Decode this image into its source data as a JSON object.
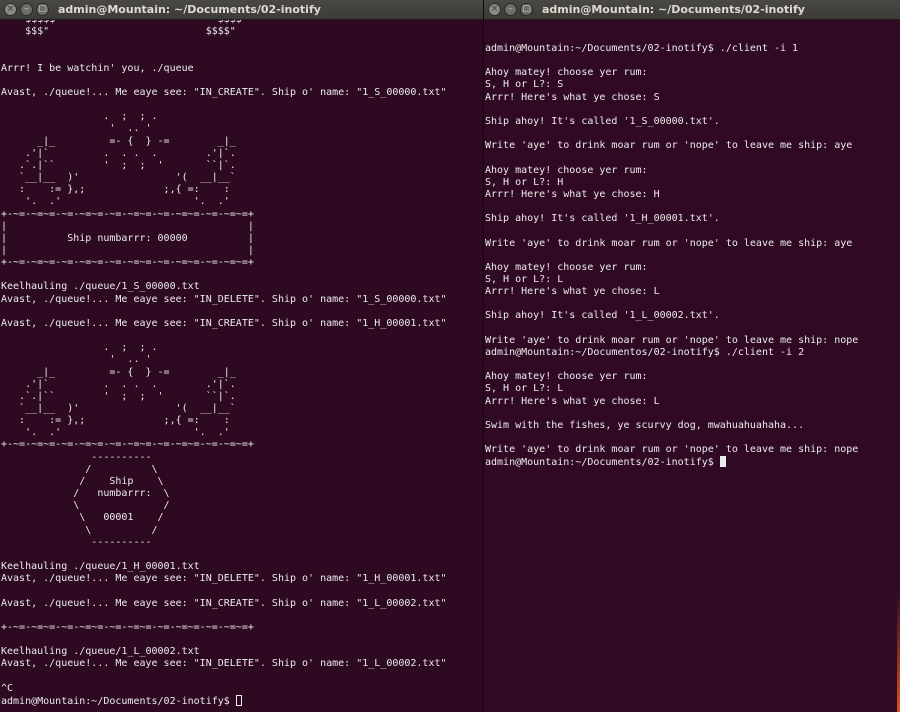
{
  "left_terminal": {
    "title": "admin@Mountain: ~/Documents/02-inotify",
    "buttons": {
      "close": "×",
      "minimize": "–",
      "maximize": "□"
    },
    "output": "   \"$$$$$\"                        \"\"$$$$\"\"\n    $$$\"                          $$$$\"\n\n\nArrr! I be watchin' you, ./queue\n\nAvast, ./queue!... Me eaye see: \"IN_CREATE\". Ship o' name: \"1_S_00000.txt\"\n\n                 .  ;  ; .\n                  '  .. '\n      _|_         =- {  } -=        _|_\n    .'|`         .  . .  .        .'|`.\n   .`.|``        '  ;  ;  '       ``|`.\n   `__|__  )'                '(  __|__`\n   :    := },;             ;,{ =:    :\n    '.  .'                      '.  .'\n+-~=-~=~=-~=-~=~=-~=-~=~=-~=-~=~=-~=-~=~=+\n|                                        |\n|          Ship numbarrr: 00000          |\n|                                        |\n+-~=-~=~=-~=-~=~=-~=-~=~=-~=-~=~=-~=-~=~=+\n\nKeelhauling ./queue/1_S_00000.txt\nAvast, ./queue!... Me eaye see: \"IN_DELETE\". Ship o' name: \"1_S_00000.txt\"\n\nAvast, ./queue!... Me eaye see: \"IN_CREATE\". Ship o' name: \"1_H_00001.txt\"\n\n                 .  ;  ; .\n                  '  .. '\n      _|_         =- {  } -=        _|_\n    .'|`         .  . .  .        .'|`.\n   .`.|``        '  ;  ;  '       ``|`.\n   `__|__  )'                '(  __|__`\n   :    := },;             ;,{ =:    :\n    '.  .'                      '.  .'\n+-~=-~=~=-~=-~=~=-~=-~=~=-~=-~=~=-~=-~=~=+\n               ----------\n              /          \\\n             /    Ship    \\\n            /   numbarrr:  \\\n            \\              /\n             \\   00001    /\n              \\          /\n               ----------\n\nKeelhauling ./queue/1_H_00001.txt\nAvast, ./queue!... Me eaye see: \"IN_DELETE\". Ship o' name: \"1_H_00001.txt\"\n\nAvast, ./queue!... Me eaye see: \"IN_CREATE\". Ship o' name: \"1_L_00002.txt\"\n\n+-~=-~=~=-~=-~=~=-~=-~=~=-~=-~=~=-~=-~=~=+\n\nKeelhauling ./queue/1_L_00002.txt\nAvast, ./queue!... Me eaye see: \"IN_DELETE\". Ship o' name: \"1_L_00002.txt\"\n\n^C\n",
    "prompt": "admin@Mountain:~/Documents/02-inotify$ "
  },
  "right_terminal": {
    "title": "admin@Mountain: ~/Documents/02-inotify",
    "buttons": {
      "close": "×",
      "minimize": "–",
      "maximize": "□"
    },
    "output": "admin@Mountain:~/Documents/02-inotify$ ./client -i 1\n\nAhoy matey! choose yer rum:\nS, H or L?: S\nArrr! Here's what ye chose: S\n\nShip ahoy! It's called '1_S_00000.txt'.\n\nWrite 'aye' to drink moar rum or 'nope' to leave me ship: aye\n\nAhoy matey! choose yer rum:\nS, H or L?: H\nArrr! Here's what ye chose: H\n\nShip ahoy! It's called '1_H_00001.txt'.\n\nWrite 'aye' to drink moar rum or 'nope' to leave me ship: aye\n\nAhoy matey! choose yer rum:\nS, H or L?: L\nArrr! Here's what ye chose: L\n\nShip ahoy! It's called '1_L_00002.txt'.\n\nWrite 'aye' to drink moar rum or 'nope' to leave me ship: nope\nadmin@Mountain:~/Documentos/02-inotify$ ./client -i 2\n\nAhoy matey! choose yer rum:\nS, H or L?: L\nArrr! Here's what ye chose: L\n\nSwim with the fishes, ye scurvy dog, mwahuahuahaha...\n\nWrite 'aye' to drink moar rum or 'nope' to leave me ship: nope\n",
    "prompt": "admin@Mountain:~/Documents/02-inotify$ "
  }
}
